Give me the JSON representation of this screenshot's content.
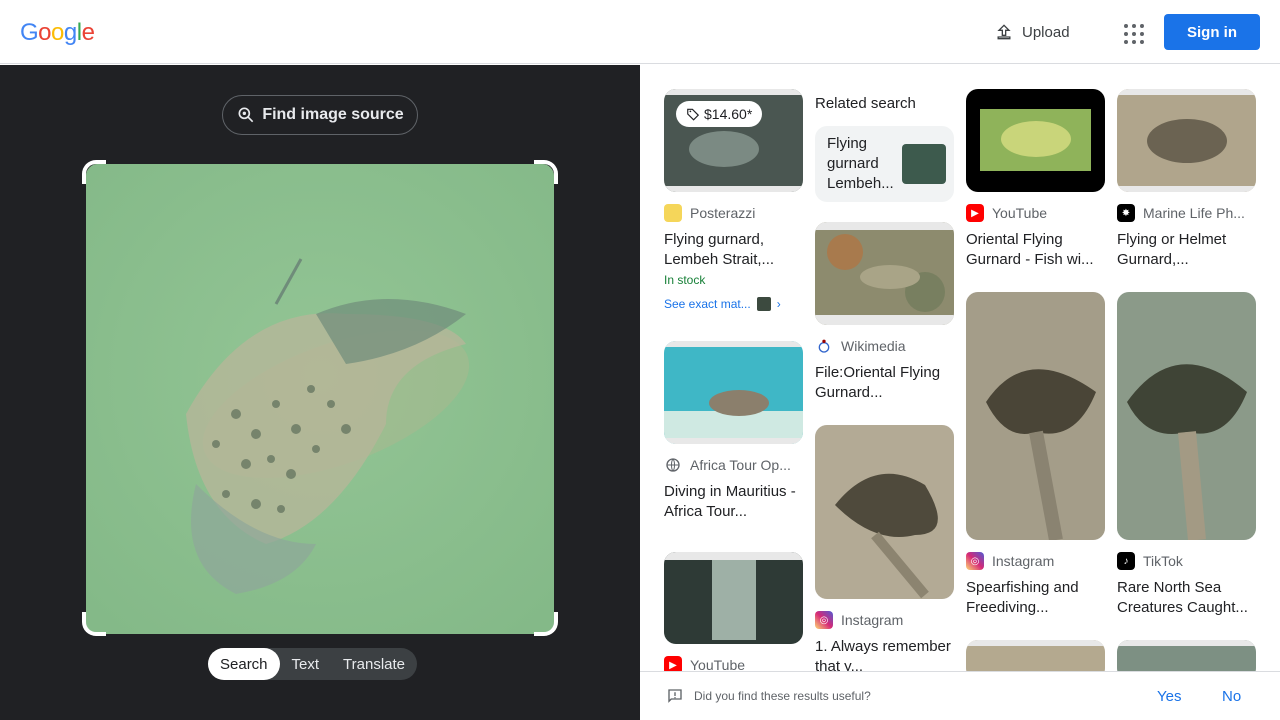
{
  "header": {
    "logo": [
      "G",
      "o",
      "o",
      "g",
      "l",
      "e"
    ],
    "logo_colors": [
      "#4285f4",
      "#ea4335",
      "#fbbc05",
      "#4285f4",
      "#34a853",
      "#ea4335"
    ],
    "upload_label": "Upload",
    "signin_label": "Sign in"
  },
  "left": {
    "find_source_label": "Find image source",
    "tabs": [
      "Search",
      "Text",
      "Translate"
    ],
    "active_tab": "Search"
  },
  "results": {
    "col1": [
      {
        "price": "$14.60*",
        "source": "Posterazzi",
        "title": "Flying gurnard, Lembeh Strait,...",
        "stock": "In stock",
        "exact": "See exact mat..."
      },
      {
        "source": "Africa Tour Op...",
        "title": "Diving in Mauritius - Africa Tour..."
      },
      {
        "source": "YouTube",
        "title": ""
      }
    ],
    "col2": {
      "related_heading": "Related search",
      "related_item": "Flying gurnard Lembeh...",
      "cards": [
        {
          "source": "Wikimedia",
          "title": "File:Oriental Flying Gurnard..."
        },
        {
          "source": "Instagram",
          "title": "1. Always remember that y..."
        }
      ]
    },
    "col3": [
      {
        "source": "YouTube",
        "title": "Oriental Flying Gurnard - Fish wi..."
      },
      {
        "source": "Instagram",
        "title": "Spearfishing and Freediving..."
      }
    ],
    "col4": [
      {
        "source": "Marine Life Ph...",
        "title": "Flying or Helmet Gurnard,..."
      },
      {
        "source": "TikTok",
        "title": "Rare North Sea Creatures Caught..."
      }
    ]
  },
  "feedback": {
    "question": "Did you find these results useful?",
    "yes": "Yes",
    "no": "No"
  },
  "colors": {
    "accent": "#1a73e8",
    "dark_panel": "#202124",
    "in_stock": "#188038"
  }
}
